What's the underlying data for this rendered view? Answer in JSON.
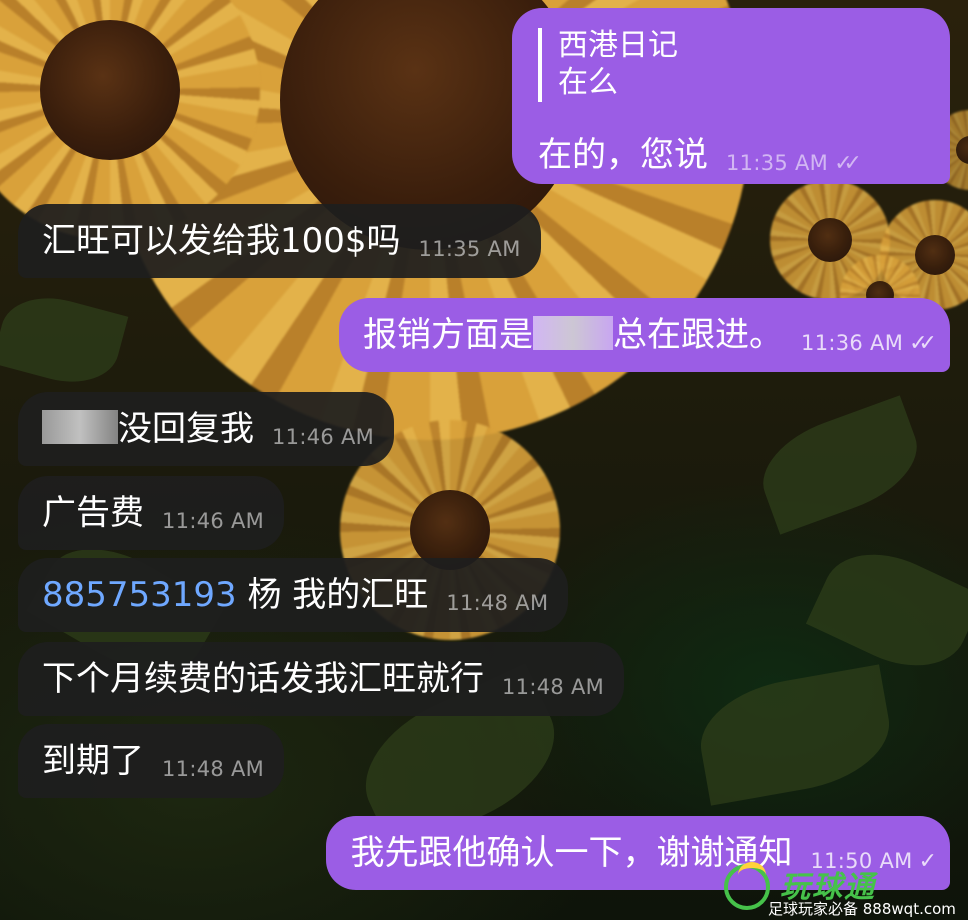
{
  "messages": {
    "m1": {
      "reply_name": "西港日记",
      "reply_text": "在么",
      "text": "在的，您说",
      "time": "11:35 AM",
      "check": "✓✓"
    },
    "m2": {
      "text": "汇旺可以发给我100$吗",
      "time": "11:35 AM"
    },
    "m3": {
      "text_before": "报销方面是",
      "text_after": "总在跟进。",
      "time": "11:36 AM",
      "check": "✓✓"
    },
    "m4": {
      "text": "没回复我",
      "time": "11:46 AM"
    },
    "m5": {
      "text": "广告费",
      "time": "11:46 AM"
    },
    "m6": {
      "link": "885753193",
      "text": " 杨 我的汇旺",
      "time": "11:48 AM"
    },
    "m7": {
      "text": "下个月续费的话发我汇旺就行",
      "time": "11:48 AM"
    },
    "m8": {
      "text": "到期了",
      "time": "11:48 AM"
    },
    "m9": {
      "text": "我先跟他确认一下，谢谢通知",
      "time": "11:50 AM",
      "check": "✓"
    }
  },
  "colors": {
    "outgoing_bubble": "#9b5de5",
    "incoming_bubble": "#1e1e1e",
    "link": "#6fa8ff"
  },
  "watermark": {
    "brand": "玩球通",
    "tagline": "足球玩家必备 888wqt.com"
  }
}
